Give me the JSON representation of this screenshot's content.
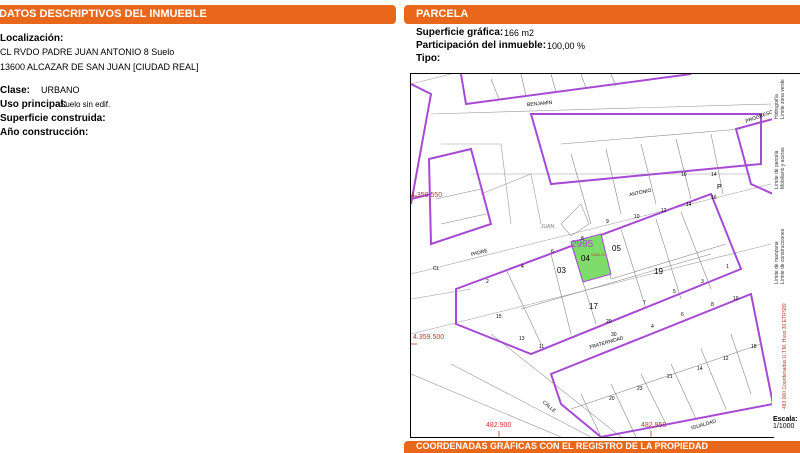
{
  "left_panel": {
    "title": "DATOS DESCRIPTIVOS DEL INMUEBLE",
    "localizacion_label": "Localización:",
    "address_line1": "CL RVDO PADRE JUAN ANTONIO 8 Suelo",
    "address_line2": "13600 ALCAZAR DE SAN JUAN [CIUDAD REAL]",
    "clase_label": "Clase:",
    "clase_value": "URBANO",
    "uso_label": "Uso principal:",
    "uso_value": "Suelo sin edif.",
    "superficie_label": "Superficie construida:",
    "anio_label": "Año construcción:"
  },
  "right_panel": {
    "title": "PARCELA",
    "superficie_grafica_label": "Superficie gráfica:",
    "superficie_grafica_value": "166 m2",
    "participacion_label": "Participación del inmueble:",
    "participacion_value": "100,00 %",
    "tipo_label": "Tipo:"
  },
  "bottom_header": "COORDENADAS GRÁFICAS CON EL REGISTRO DE LA PROPIEDAD",
  "map": {
    "coord_y1": "4.359.550",
    "coord_y2": "4.359.500",
    "coord_x1": "482.900",
    "coord_x2": "482.950",
    "parcel_ref": "2995",
    "highlight_parcel": "04",
    "highlight_note": "SUELO",
    "parcels": [
      "03",
      "05",
      "19",
      "17"
    ],
    "streets": [
      "BENJAMÍN",
      "ANTONIO",
      "JUAN",
      "PADRE",
      "FRATERNIDAD",
      "CALLE",
      "CL",
      "PROGRESO",
      "IGUALDAD",
      "P"
    ],
    "numbers": [
      "9",
      "10",
      "12",
      "14",
      "16",
      "2",
      "4",
      "6",
      "8",
      "1",
      "3",
      "5",
      "7",
      "11",
      "13",
      "15",
      "20",
      "30",
      "4",
      "6",
      "8",
      "10",
      "12",
      "14",
      "21",
      "23",
      "20",
      "18",
      "14",
      "10"
    ]
  },
  "legend": {
    "items": [
      "Límite de parcela",
      "Mobiliario y aceras",
      "Límite de manzana",
      "Límite de construcciones",
      "Hidrografía",
      "Límite zona verde"
    ],
    "projection": "483.000 Coordenadas U.T.M. Huso 30 ETRS89",
    "escala_label": "Escala:",
    "escala_value": "1/1000"
  },
  "colors": {
    "header": "#e8671b",
    "parcel_line": "#a64ad6",
    "highlight": "#7ddc6a",
    "coord": "#c0392b"
  }
}
